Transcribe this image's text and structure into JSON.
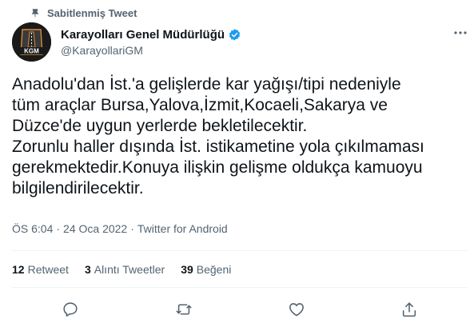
{
  "pinned_label": "Sabitlenmiş Tweet",
  "author": {
    "display_name": "Karayolları Genel Müdürlüğü",
    "handle": "@KarayollariGM",
    "avatar_text": "KGM",
    "verified": true
  },
  "tweet_text": "Anadolu'dan İst.'a gelişlerde kar yağışı/tipi nedeniyle\ntüm araçlar Bursa,Yalova,İzmit,Kocaeli,Sakarya ve\nDüzce'de uygun yerlerde bekletilecektir.\nZorunlu haller dışında İst. istikametine yola çıkılmaması\ngerekmektedir.Konuya ilişkin gelişme oldukça kamuoyu\nbilgilendirilecektir.",
  "meta": {
    "time": "ÖS 6:04",
    "separator": "·",
    "date": "24 Oca 2022",
    "source": "Twitter for Android"
  },
  "stats": [
    {
      "count": "12",
      "label": "Retweet"
    },
    {
      "count": "3",
      "label": "Alıntı Tweetler"
    },
    {
      "count": "39",
      "label": "Beğeni"
    }
  ],
  "icons": {
    "pin": "pin-icon",
    "verified": "verified-badge-icon",
    "more": "more-dots-icon",
    "reply": "reply-icon",
    "retweet": "retweet-icon",
    "like": "heart-icon",
    "share": "share-icon"
  },
  "colors": {
    "text": "#0f1419",
    "secondary": "#536471",
    "verified": "#1d9bf0",
    "divider": "#eff3f4"
  }
}
